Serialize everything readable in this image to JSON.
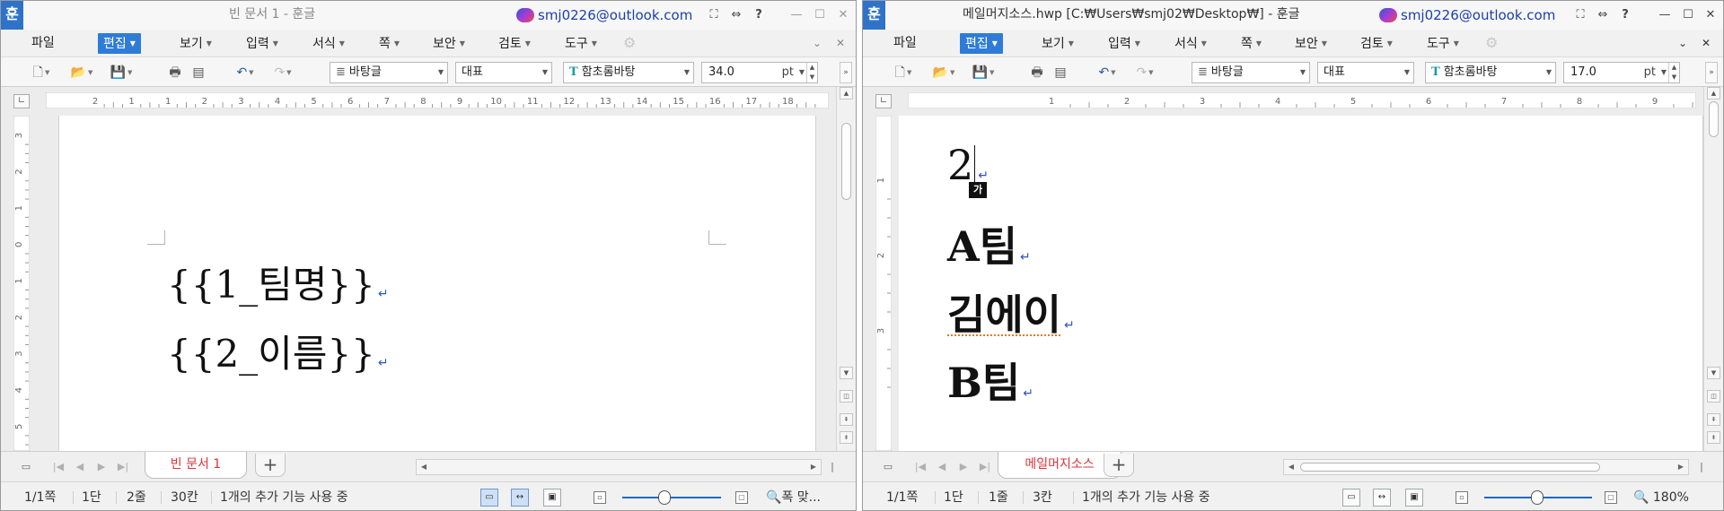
{
  "windows": [
    {
      "title": "빈 문서 1 - 훈글",
      "app_icon": "훈",
      "account": "smj0226@outlook.com",
      "menus": [
        "파일",
        "편집",
        "보기",
        "입력",
        "서식",
        "쪽",
        "보안",
        "검토",
        "도구"
      ],
      "active_menu": "편집",
      "toolbar": {
        "style": "바탕글",
        "language": "대표",
        "font": "함초롬바탕",
        "size": "34.0",
        "unit": "pt"
      },
      "ruler_labels": [
        "2",
        "1",
        "1",
        "2",
        "3",
        "4",
        "5",
        "6",
        "7",
        "8",
        "9",
        "10",
        "11",
        "12",
        "13",
        "14",
        "15",
        "16",
        "17",
        "18"
      ],
      "vruler_labels": [
        "3",
        "2",
        "1",
        "0",
        "1",
        "2",
        "3",
        "4",
        "5",
        "6"
      ],
      "doc_lines": [
        "{{1_팀명}}",
        "{{2_이름}}"
      ],
      "tab_label": "빈 문서 1",
      "status": {
        "page": "1/1쪽",
        "column": "1단",
        "line": "2줄",
        "char": "30칸",
        "addon": "1개의 추가 기능 사용 중",
        "zoom": "폭 맞..."
      }
    },
    {
      "title": "메일머지소스.hwp [C:₩Users₩smj02₩Desktop₩] - 훈글",
      "app_icon": "훈",
      "account": "smj0226@outlook.com",
      "menus": [
        "파일",
        "편집",
        "보기",
        "입력",
        "서식",
        "쪽",
        "보안",
        "검토",
        "도구"
      ],
      "active_menu": "편집",
      "toolbar": {
        "style": "바탕글",
        "language": "대표",
        "font": "함초롬바탕",
        "size": "17.0",
        "unit": "pt"
      },
      "ruler_labels": [
        "1",
        "2",
        "3",
        "4",
        "5",
        "6",
        "7",
        "8",
        "9"
      ],
      "vruler_labels": [
        "1",
        "2",
        "3"
      ],
      "doc_lines": [
        "2",
        "A팀",
        "김에이",
        "B팀"
      ],
      "ime_indicator": "가",
      "tab_label": "메일머지소스",
      "status": {
        "page": "1/1쪽",
        "column": "1단",
        "line": "1줄",
        "char": "3칸",
        "addon": "1개의 추가 기능 사용 중",
        "zoom": "180%"
      }
    }
  ],
  "icons": {
    "fullscreen": "⛶",
    "restore": "⇔",
    "help": "?",
    "minimize": "—",
    "maximize": "☐",
    "close": "✕",
    "new": "🗋",
    "open": "📂",
    "save": "💾",
    "print": "🖶",
    "undo": "↶",
    "redo": "↷",
    "search": "🔍"
  }
}
